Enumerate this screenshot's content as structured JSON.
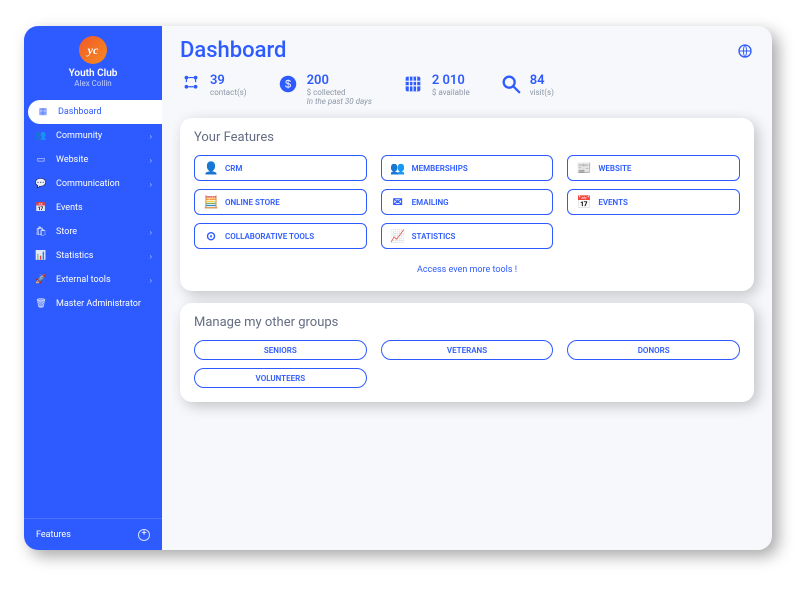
{
  "brand": {
    "logo_text": "yc",
    "club": "Youth Club",
    "user": "Alex Collin"
  },
  "nav": {
    "items": [
      {
        "icon": "dashboard-icon",
        "glyph": "▦",
        "label": "Dashboard",
        "active": true,
        "expandable": false
      },
      {
        "icon": "community-icon",
        "glyph": "👥",
        "label": "Community",
        "active": false,
        "expandable": true
      },
      {
        "icon": "website-icon",
        "glyph": "▭",
        "label": "Website",
        "active": false,
        "expandable": true
      },
      {
        "icon": "comm-icon",
        "glyph": "💬",
        "label": "Communication",
        "active": false,
        "expandable": true
      },
      {
        "icon": "events-icon",
        "glyph": "📅",
        "label": "Events",
        "active": false,
        "expandable": false
      },
      {
        "icon": "store-icon",
        "glyph": "🛍",
        "label": "Store",
        "active": false,
        "expandable": true
      },
      {
        "icon": "stats-icon",
        "glyph": "📊",
        "label": "Statistics",
        "active": false,
        "expandable": true
      },
      {
        "icon": "external-icon",
        "glyph": "🚀",
        "label": "External tools",
        "active": false,
        "expandable": true
      },
      {
        "icon": "admin-icon",
        "glyph": "🗑",
        "label": "Master Administrator",
        "active": false,
        "expandable": false
      }
    ],
    "features_label": "Features"
  },
  "page_title": "Dashboard",
  "stats": [
    {
      "value": "39",
      "sub": "contact(s)",
      "note": "",
      "icon": "contacts-icon"
    },
    {
      "value": "200",
      "sub": "$ collected",
      "note": "In the past 30 days",
      "icon": "collected-icon"
    },
    {
      "value": "2 010",
      "sub": "$ available",
      "note": "",
      "icon": "available-icon"
    },
    {
      "value": "84",
      "sub": "visit(s)",
      "note": "",
      "icon": "visits-icon"
    }
  ],
  "features_card": {
    "title": "Your Features",
    "items": [
      {
        "icon": "👤",
        "label": "CRM"
      },
      {
        "icon": "👥",
        "label": "MEMBERSHIPS"
      },
      {
        "icon": "📰",
        "label": "WEBSITE"
      },
      {
        "icon": "🧮",
        "label": "ONLINE STORE"
      },
      {
        "icon": "✉",
        "label": "EMAILING"
      },
      {
        "icon": "📅",
        "label": "EVENTS"
      },
      {
        "icon": "⊙",
        "label": "COLLABORATIVE TOOLS"
      },
      {
        "icon": "📈",
        "label": "STATISTICS"
      }
    ],
    "more_link": "Access even more tools !"
  },
  "groups_card": {
    "title": "Manage my other groups",
    "items": [
      "SENIORS",
      "VETERANS",
      "DONORS",
      "VOLUNTEERS"
    ]
  }
}
